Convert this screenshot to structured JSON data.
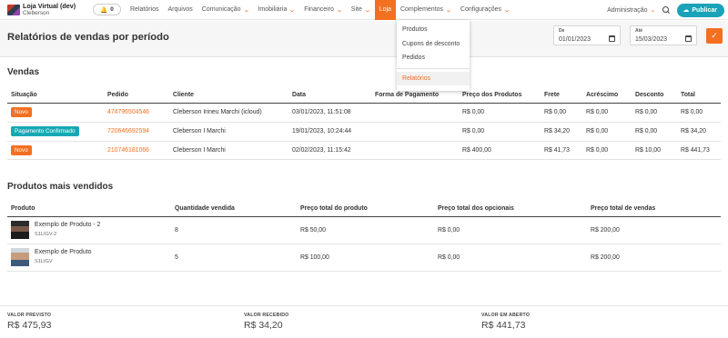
{
  "brand": {
    "name": "Loja Virtual (dev)",
    "user": "Cleberson"
  },
  "notifications": {
    "count": "0"
  },
  "nav": [
    {
      "label": "Relatórios",
      "dropdown": false,
      "active": false
    },
    {
      "label": "Arquivos",
      "dropdown": false,
      "active": false
    },
    {
      "label": "Comunicação",
      "dropdown": true,
      "active": false
    },
    {
      "label": "Imobiliária",
      "dropdown": true,
      "active": false
    },
    {
      "label": "Financeiro",
      "dropdown": true,
      "active": false
    },
    {
      "label": "Site",
      "dropdown": true,
      "active": false
    },
    {
      "label": "Loja",
      "dropdown": false,
      "active": true
    },
    {
      "label": "Complementos",
      "dropdown": true,
      "active": false
    },
    {
      "label": "Configurações",
      "dropdown": true,
      "active": false
    }
  ],
  "nav_right": {
    "admin": "Administração",
    "publish": "Publicar"
  },
  "loja_menu": {
    "items": [
      "Produtos",
      "Cupons de desconto",
      "Pedidos"
    ],
    "reports": "Relatórios"
  },
  "page": {
    "title": "Relatórios de vendas por período",
    "from_label": "De",
    "from_value": "01/01/2023",
    "to_label": "Até",
    "to_value": "15/03/2023",
    "go": "✓"
  },
  "sales": {
    "title": "Vendas",
    "headers": [
      "Situação",
      "Pedido",
      "Cliente",
      "Data",
      "Forma de Pagamento",
      "Preço dos Produtos",
      "Frete",
      "Acréscimo",
      "Desconto",
      "Total"
    ],
    "rows": [
      {
        "status": "Novo",
        "status_color": "#f37021",
        "order": "474796504546",
        "client": "Cleberson Irineu Marchi (icloud)",
        "date": "03/01/2023, 11:51:08",
        "payment": "",
        "products": "R$ 0,00",
        "shipping": "R$ 0,00",
        "surcharge": "R$ 0,00",
        "discount": "R$ 0,00",
        "total": "R$ 0,00"
      },
      {
        "status": "Pagamento Confirmado",
        "status_color": "#17a8b5",
        "order": "720646692594",
        "client": "Cleberson I Marchi",
        "date": "19/01/2023, 10:24:44",
        "payment": "",
        "products": "R$ 0,00",
        "shipping": "R$ 34,20",
        "surcharge": "R$ 0,00",
        "discount": "R$ 0,00",
        "total": "R$ 34,20"
      },
      {
        "status": "Novo",
        "status_color": "#f37021",
        "order": "210746181066",
        "client": "Cleberson I Marchi",
        "date": "02/02/2023, 11:15:42",
        "payment": "",
        "products": "R$ 400,00",
        "shipping": "R$ 41,73",
        "surcharge": "R$ 0,00",
        "discount": "R$ 10,00",
        "total": "R$ 441,73"
      }
    ]
  },
  "top_products": {
    "title": "Produtos mais vendidos",
    "headers": [
      "Produto",
      "Quantidade vendida",
      "Preço total do produto",
      "Preço total dos opcionais",
      "Preço total de vendas"
    ],
    "rows": [
      {
        "name": "Exemplo de Produto - 2",
        "sku": "S1LIGV-2",
        "qty": "8",
        "product_total": "R$ 50,00",
        "options_total": "R$ 0,00",
        "sales_total": "R$ 200,00"
      },
      {
        "name": "Exemplo de Produto",
        "sku": "S1LIGV",
        "qty": "5",
        "product_total": "R$ 100,00",
        "options_total": "R$ 0,00",
        "sales_total": "R$ 200,00"
      }
    ]
  },
  "summary": {
    "expected_label": "VALOR PREVISTO",
    "expected": "R$ 475,93",
    "received_label": "VALOR RECEBIDO",
    "received": "R$ 34,20",
    "open_label": "VALOR EM ABERTO",
    "open": "R$ 441,73"
  }
}
